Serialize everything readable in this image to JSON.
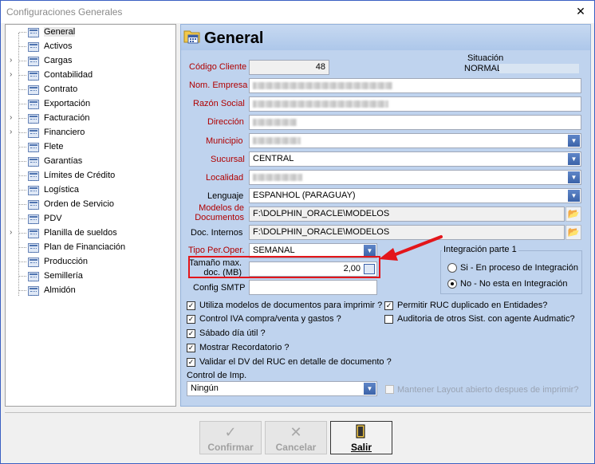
{
  "window": {
    "title": "Configuraciones Generales",
    "close_label": "✕"
  },
  "sidebar": {
    "items": [
      {
        "label": "General",
        "expandable": false
      },
      {
        "label": "Activos",
        "expandable": false
      },
      {
        "label": "Cargas",
        "expandable": true
      },
      {
        "label": "Contabilidad",
        "expandable": true
      },
      {
        "label": "Contrato",
        "expandable": false
      },
      {
        "label": "Exportación",
        "expandable": false
      },
      {
        "label": "Facturación",
        "expandable": true
      },
      {
        "label": "Financiero",
        "expandable": true
      },
      {
        "label": "Flete",
        "expandable": false
      },
      {
        "label": "Garantías",
        "expandable": false
      },
      {
        "label": "Límites de Crédito",
        "expandable": false
      },
      {
        "label": "Logística",
        "expandable": false
      },
      {
        "label": "Orden de Servicio",
        "expandable": false
      },
      {
        "label": "PDV",
        "expandable": false
      },
      {
        "label": "Planilla de sueldos",
        "expandable": true
      },
      {
        "label": "Plan de Financiación",
        "expandable": false
      },
      {
        "label": "Producción",
        "expandable": false
      },
      {
        "label": "Semillería",
        "expandable": false
      },
      {
        "label": "Almidón",
        "expandable": false
      }
    ]
  },
  "panel": {
    "title": "General",
    "codigo_cliente": {
      "label": "Código Cliente",
      "value": "48"
    },
    "situacion": {
      "label": "Situación",
      "value": "NORMAL"
    },
    "nom_empresa": {
      "label": "Nom. Empresa"
    },
    "razon_social": {
      "label": "Razón Social"
    },
    "direccion": {
      "label": "Dirección"
    },
    "municipio": {
      "label": "Municipio"
    },
    "sucursal": {
      "label": "Sucursal",
      "value": "CENTRAL"
    },
    "localidad": {
      "label": "Localidad"
    },
    "lenguaje": {
      "label": "Lenguaje",
      "value": "ESPANHOL (PARAGUAY)"
    },
    "modelos": {
      "label_1": "Modelos de",
      "label_2": "Documentos",
      "value": "F:\\DOLPHIN_ORACLE\\MODELOS"
    },
    "doc_internos": {
      "label": "Doc. Internos",
      "value": "F:\\DOLPHIN_ORACLE\\MODELOS"
    },
    "tipo_per": {
      "label": "Tipo Per.Oper.",
      "value": "SEMANAL"
    },
    "tamano": {
      "label_1": "Tamaño max.",
      "label_2": "doc. (MB)",
      "value": "2,00"
    },
    "config_smtp": {
      "label": "Config SMTP",
      "value": ""
    },
    "integracion": {
      "title": "Integración parte 1",
      "options": [
        "Si - En proceso de Integración",
        "No - No esta en Integración"
      ],
      "selected": "No - No esta en Integración"
    },
    "checks_left": [
      {
        "label": "Utiliza modelos de documentos para imprimir ?",
        "checked": true
      },
      {
        "label": "Control IVA compra/venta y gastos ?",
        "checked": true
      },
      {
        "label": "Sábado día útil ?",
        "checked": true
      },
      {
        "label": "Mostrar Recordatorio ?",
        "checked": true
      },
      {
        "label": "Validar el DV del RUC en detalle de documento ?",
        "checked": true
      }
    ],
    "checks_right": [
      {
        "label": "Permitir RUC duplicado en Entidades?",
        "checked": true
      },
      {
        "label": "Auditoria de otros Sist. con agente Audmatic?",
        "checked": false
      }
    ],
    "control_imp": {
      "label": "Control de Imp.",
      "value": "Ningún"
    },
    "mantener_layout": {
      "label": "Mantener Layout abierto despues de imprimir?",
      "checked": false
    }
  },
  "footer": {
    "confirmar": "Confirmar",
    "cancelar": "Cancelar",
    "salir": "Salir"
  },
  "colors": {
    "panel_bg": "#bfd3ee",
    "label_red": "#b00000",
    "highlight": "#e3161b"
  }
}
